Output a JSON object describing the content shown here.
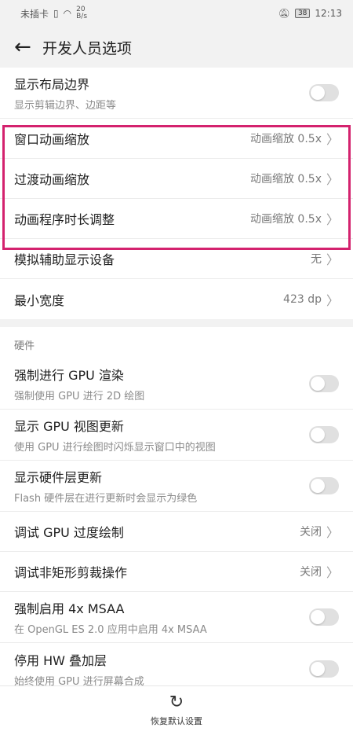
{
  "status": {
    "carrier": "未插卡",
    "speed_top": "20",
    "speed_bottom": "B/s",
    "battery": "38",
    "time": "12:13"
  },
  "header": {
    "title": "开发人员选项"
  },
  "group1": {
    "items": [
      {
        "label": "显示布局边界",
        "sub": "显示剪辑边界、边距等",
        "control": "toggle",
        "on": false
      },
      {
        "label": "窗口动画缩放",
        "value": "动画缩放 0.5x"
      },
      {
        "label": "过渡动画缩放",
        "value": "动画缩放 0.5x"
      },
      {
        "label": "动画程序时长调整",
        "value": "动画缩放 0.5x"
      },
      {
        "label": "模拟辅助显示设备",
        "value": "无"
      },
      {
        "label": "最小宽度",
        "value": "423 dp"
      }
    ]
  },
  "hardware": {
    "header": "硬件",
    "items": [
      {
        "label": "强制进行 GPU 渲染",
        "sub": "强制使用 GPU 进行 2D 绘图",
        "control": "toggle",
        "on": false
      },
      {
        "label": "显示 GPU 视图更新",
        "sub": "使用 GPU 进行绘图时闪烁显示窗口中的视图",
        "control": "toggle",
        "on": false
      },
      {
        "label": "显示硬件层更新",
        "sub": "Flash 硬件层在进行更新时会显示为绿色",
        "control": "toggle",
        "on": false
      },
      {
        "label": "调试 GPU 过度绘制",
        "value": "关闭"
      },
      {
        "label": "调试非矩形剪裁操作",
        "value": "关闭"
      },
      {
        "label": "强制启用 4x MSAA",
        "sub": "在 OpenGL ES 2.0 应用中启用 4x MSAA",
        "control": "toggle",
        "on": false
      },
      {
        "label": "停用 HW 叠加层",
        "sub": "始终使用 GPU 进行屏幕合成",
        "control": "toggle",
        "on": false
      }
    ]
  },
  "bottom": {
    "reset_label": "恢复默认设置"
  },
  "colors": {
    "highlight": "#d4226e"
  }
}
